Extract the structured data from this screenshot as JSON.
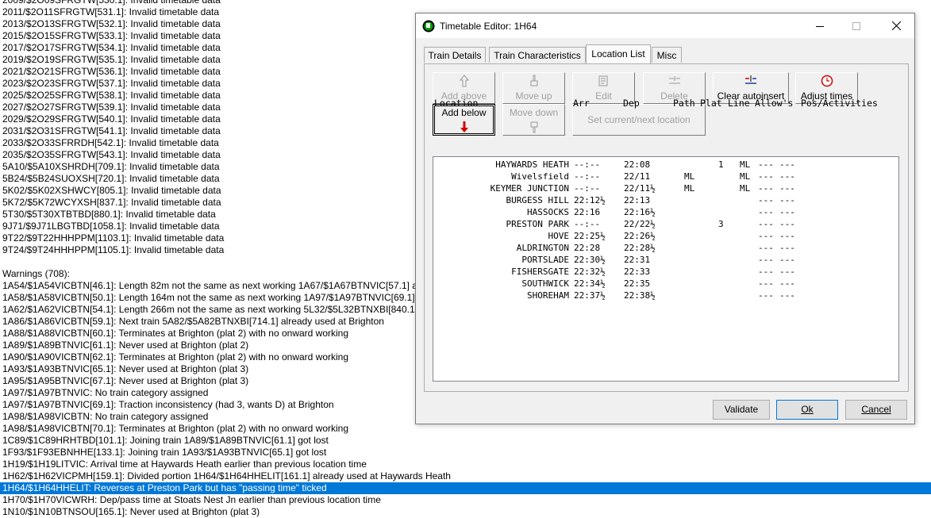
{
  "log_lines": [
    "2009/$2O09SFRGTW[530.1]: Invalid timetable data",
    "2011/$2O11SFRGTW[531.1]: Invalid timetable data",
    "2013/$2O13SFRGTW[532.1]: Invalid timetable data",
    "2015/$2O15SFRGTW[533.1]: Invalid timetable data",
    "2017/$2O17SFRGTW[534.1]: Invalid timetable data",
    "2019/$2O19SFRGTW[535.1]: Invalid timetable data",
    "2021/$2O21SFRGTW[536.1]: Invalid timetable data",
    "2023/$2O23SFRGTW[537.1]: Invalid timetable data",
    "2025/$2O25SFRGTW[538.1]: Invalid timetable data",
    "2027/$2O27SFRGTW[539.1]: Invalid timetable data",
    "2029/$2O29SFRGTW[540.1]: Invalid timetable data",
    "2031/$2O31SFRGTW[541.1]: Invalid timetable data",
    "2033/$2O33SFRRDH[542.1]: Invalid timetable data",
    "2035/$2O35SFRGTW[543.1]: Invalid timetable data",
    "5A10/$5A10XSHRDH[709.1]: Invalid timetable data",
    "5B24/$5B24SUOXSH[720.1]: Invalid timetable data",
    "5K02/$5K02XSHWCY[805.1]: Invalid timetable data",
    "5K72/$5K72WCYXSH[837.1]: Invalid timetable data",
    "5T30/$5T30XTBTBD[880.1]: Invalid timetable data",
    "9J71/$9J71LBGTBD[1058.1]: Invalid timetable data",
    "9T22/$9T22HHHPPM[1103.1]: Invalid timetable data",
    "9T24/$9T24HHHPPM[1105.1]: Invalid timetable data",
    "",
    "Warnings (708):",
    "1A54/$1A54VICBTN[46.1]: Length 82m not the same as next working 1A67/$1A67BTNVIC[57.1] a",
    "1A58/$1A58VICBTN[50.1]: Length 164m not the same as next working 1A97/$1A97BTNVIC[69.1]",
    "1A62/$1A62VICBTN[54.1]: Length 266m not the same as next working 5L32/$5L32BTNXBI[840.1",
    "1A86/$1A86VICBTN[59.1]: Next train 5A82/$5A82BTNXBI[714.1] already used at Brighton",
    "1A88/$1A88VICBTN[60.1]: Terminates at Brighton (plat 2) with no onward working",
    "1A89/$1A89BTNVIC[61.1]: Never used at Brighton (plat 2)",
    "1A90/$1A90VICBTN[62.1]: Terminates at Brighton (plat 2) with no onward working",
    "1A93/$1A93BTNVIC[65.1]: Never used at Brighton (plat 3)",
    "1A95/$1A95BTNVIC[67.1]: Never used at Brighton (plat 3)",
    "1A97/$1A97BTNVIC: No train category assigned",
    "1A97/$1A97BTNVIC[69.1]: Traction inconsistency (had 3, wants D) at Brighton",
    "1A98/$1A98VICBTN: No train category assigned",
    "1A98/$1A98VICBTN[70.1]: Terminates at Brighton (plat 2) with no onward working",
    "1C89/$1C89HRHTBD[101.1]: Joining train 1A89/$1A89BTNVIC[61.1] got lost",
    "1F93/$1F93EBNHHE[133.1]: Joining train 1A93/$1A93BTNVIC[65.1] got lost",
    "1H19/$1H19LITVIC: Arrival time at Haywards Heath earlier than previous location time",
    "1H62/$1H62VICPMH[159.1]: Divided portion 1H64/$1H64HHELIT[161.1] already used at Haywards Heath",
    "1H64/$1H64HHELIT: Reverses at Preston Park but has \"passing time\" ticked",
    "1H70/$1H70VICWRH: Dep/pass time at Stoats Nest Jn earlier than previous location time",
    "1N10/$1N10BTNSOU[165.1]: Never used at Brighton (plat 3)"
  ],
  "selected_log_line": "1H64/$1H64HHELIT: Reverses at Preston Park but has \"passing time\" ticked",
  "dialog": {
    "title": "Timetable Editor: 1H64",
    "tabs": [
      "Train Details",
      "Train Characteristics",
      "Location List",
      "Misc"
    ],
    "active_tab": "Location List",
    "buttons": {
      "add_above": "Add above",
      "move_up": "Move up",
      "edit": "Edit",
      "delete": "Delete",
      "clear_autoinsert": "Clear autoinsert",
      "adjust_times": "Adjust times",
      "add_below": "Add below",
      "move_down": "Move down",
      "set_current": "Set current/next location"
    },
    "headers": {
      "location": "Location",
      "arr": "Arr",
      "dep": "Dep",
      "path": "Path",
      "plat": "Plat",
      "line": "Line",
      "allows": "Allow's",
      "pos": "Pos/Activities"
    },
    "rows": [
      {
        "loc": "HAYWARDS HEATH",
        "arr": "--:--",
        "dep": "22:08",
        "path": "",
        "plat": "1",
        "line": "ML",
        "allow": "---",
        "pos": "---"
      },
      {
        "loc": "Wivelsfield",
        "arr": "--:--",
        "dep": "22/11",
        "path": "ML",
        "plat": "",
        "line": "ML",
        "allow": "---",
        "pos": "---"
      },
      {
        "loc": "KEYMER JUNCTION",
        "arr": "--:--",
        "dep": "22/11½",
        "path": "ML",
        "plat": "",
        "line": "ML",
        "allow": "---",
        "pos": "---"
      },
      {
        "loc": "BURGESS HILL",
        "arr": "22:12½",
        "dep": "22:13",
        "path": "",
        "plat": "",
        "line": "",
        "allow": "---",
        "pos": "---"
      },
      {
        "loc": "HASSOCKS",
        "arr": "22:16",
        "dep": "22:16½",
        "path": "",
        "plat": "",
        "line": "",
        "allow": "---",
        "pos": "---"
      },
      {
        "loc": "PRESTON PARK",
        "arr": "--:--",
        "dep": "22/22½",
        "path": "",
        "plat": "3",
        "line": "",
        "allow": "---",
        "pos": "---"
      },
      {
        "loc": "HOVE",
        "arr": "22:25½",
        "dep": "22:26½",
        "path": "",
        "plat": "",
        "line": "",
        "allow": "---",
        "pos": "---"
      },
      {
        "loc": "ALDRINGTON",
        "arr": "22:28",
        "dep": "22:28½",
        "path": "",
        "plat": "",
        "line": "",
        "allow": "---",
        "pos": "---"
      },
      {
        "loc": "PORTSLADE",
        "arr": "22:30½",
        "dep": "22:31",
        "path": "",
        "plat": "",
        "line": "",
        "allow": "---",
        "pos": "---"
      },
      {
        "loc": "FISHERSGATE",
        "arr": "22:32½",
        "dep": "22:33",
        "path": "",
        "plat": "",
        "line": "",
        "allow": "---",
        "pos": "---"
      },
      {
        "loc": "SOUTHWICK",
        "arr": "22:34½",
        "dep": "22:35",
        "path": "",
        "plat": "",
        "line": "",
        "allow": "---",
        "pos": "---"
      },
      {
        "loc": "SHOREHAM",
        "arr": "22:37½",
        "dep": "22:38½",
        "path": "",
        "plat": "",
        "line": "",
        "allow": "---",
        "pos": "---"
      }
    ],
    "footer": {
      "validate": "Validate",
      "ok": "Ok",
      "cancel": "Cancel"
    }
  },
  "colors": {
    "selection": "#0078d7",
    "disabled_text": "#a0a0a0",
    "accent_red": "#d00000"
  }
}
